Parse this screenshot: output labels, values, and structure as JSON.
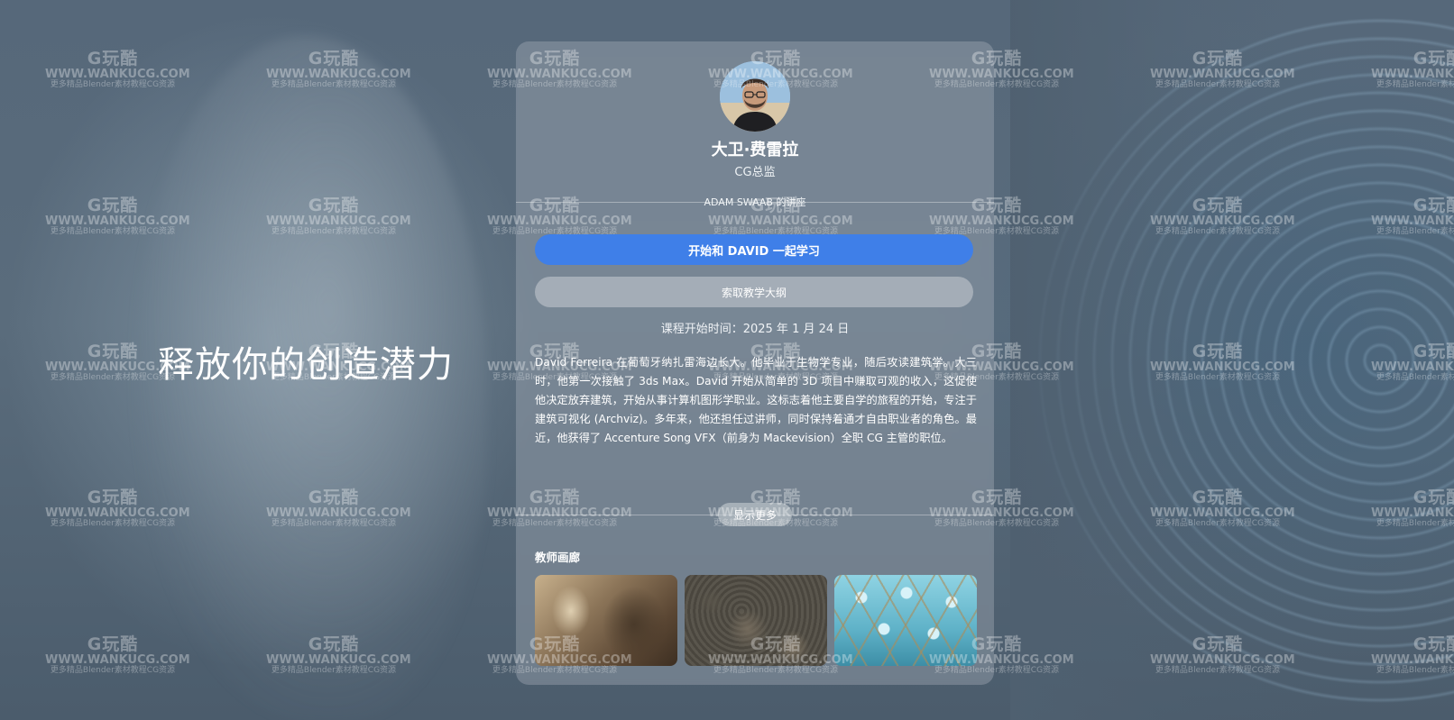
{
  "hero": {
    "title": "释放你的创造潜力"
  },
  "instructor": {
    "avatar_icon": "avatar-photo",
    "name": "大卫·费雷拉",
    "role": "CG总监"
  },
  "course": {
    "lecture_label": "ADAM SWAAB 的讲座",
    "primary_button": "开始和 DAVID 一起学习",
    "secondary_button": "索取教学大纲",
    "start_date": "课程开始时间：2025 年 1 月 24 日",
    "bio": "David Ferreira 在葡萄牙纳扎雷海边长大。他毕业于生物学专业，随后攻读建筑学。大三时，他第一次接触了 3ds Max。David 开始从简单的 3D 项目中赚取可观的收入，这促使他决定放弃建筑，开始从事计算机图形学职业。这标志着他主要自学的旅程的开始，专注于建筑可视化 (Archviz)。多年来，他还担任过讲师，同时保持着通才自由职业者的角色。最近，他获得了 Accenture Song VFX（前身为 Mackevision）全职 CG 主管的职位。",
    "show_more": "显示更多"
  },
  "gallery": {
    "title": "教师画廊",
    "items": [
      {
        "icon": "canyon-rock-image"
      },
      {
        "icon": "crater-surface-image"
      },
      {
        "icon": "hexagon-cells-image"
      }
    ]
  },
  "watermark": {
    "logo": "G玩酷",
    "url": "WWW.WANKUCG.COM",
    "sub": "更多精品Blender素材教程CG资源"
  },
  "colors": {
    "accent": "#3f7fe8",
    "background": "#56687a"
  }
}
